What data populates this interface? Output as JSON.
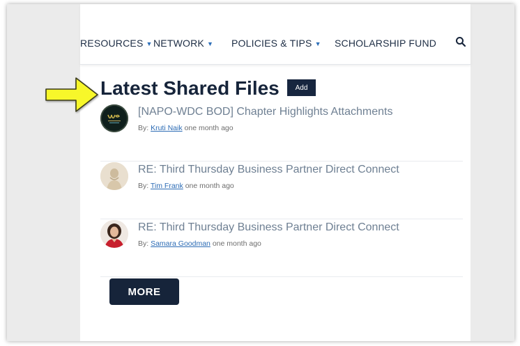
{
  "nav": {
    "items": [
      {
        "label": "RESOURCES",
        "has_caret": true
      },
      {
        "label": "NETWORK",
        "has_caret": true
      },
      {
        "label": "POLICIES & TIPS",
        "has_caret": true
      },
      {
        "label": "SCHOLARSHIP FUND",
        "has_caret": false
      }
    ],
    "caret_glyph": "▼",
    "search_icon": "search-icon"
  },
  "section": {
    "title": "Latest Shared Files",
    "add_label": "Add"
  },
  "files": [
    {
      "title": "[NAPO-WDC BOD] Chapter Highlights Attachments",
      "by_label": "By:",
      "author": "Kruti Naik",
      "time": "one month ago",
      "avatar_style": "logo-dark"
    },
    {
      "title": "RE: Third Thursday Business Partner Direct Connect",
      "by_label": "By:",
      "author": "Tim Frank",
      "time": "one month ago",
      "avatar_style": "photo-beige"
    },
    {
      "title": "RE: Third Thursday Business Partner Direct Connect",
      "by_label": "By:",
      "author": "Samara Goodman",
      "time": "one month ago",
      "avatar_style": "photo-portrait"
    }
  ],
  "more_label": "MORE",
  "colors": {
    "navy": "#16243a",
    "link_blue": "#2d6cb5",
    "title_gray": "#6f8093",
    "arrow_yellow": "#f7f72a"
  }
}
